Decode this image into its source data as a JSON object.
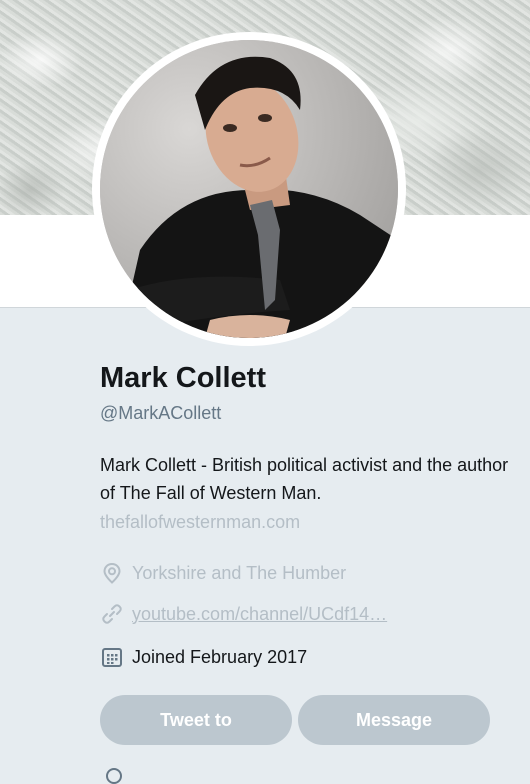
{
  "profile": {
    "name": "Mark Collett",
    "handle": "@MarkACollett",
    "bio": "Mark Collett - British political activist and the author of The Fall of Western Man.",
    "bio_link": "thefallofwesternman.com",
    "location": "Yorkshire and The Humber",
    "website": "youtube.com/channel/UCdf14…",
    "joined": "Joined February 2017"
  },
  "icons": {
    "location": "location-pin-icon",
    "link": "link-icon",
    "calendar": "calendar-icon"
  },
  "actions": {
    "tweet_to": "Tweet to",
    "message": "Message"
  },
  "colors": {
    "background": "#e6ecf0",
    "muted_text": "#b4bec6",
    "button": "#bcc7cf"
  }
}
